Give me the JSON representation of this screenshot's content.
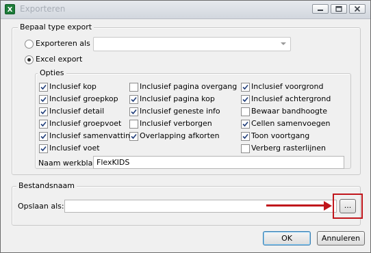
{
  "window": {
    "title": "Exporteren",
    "app_icon_glyph": "X",
    "app_icon_color": "#1d7c3a",
    "controls": [
      "minimize-icon",
      "maximize-icon",
      "close-icon"
    ]
  },
  "export_type": {
    "group_title": "Bepaal type export",
    "option_export_as_label": "Exporteren als :",
    "option_export_as_selected": false,
    "export_as_combo_value": "",
    "option_excel_label": "Excel export",
    "option_excel_selected": true
  },
  "options": {
    "group_title": "Opties",
    "checkboxes": [
      {
        "label": "Inclusief kop",
        "checked": true
      },
      {
        "label": "Inclusief groepkop",
        "checked": true
      },
      {
        "label": "Inclusief detail",
        "checked": true
      },
      {
        "label": "Inclusief groepvoet",
        "checked": true
      },
      {
        "label": "Inclusief samenvatting",
        "checked": true
      },
      {
        "label": "Inclusief voet",
        "checked": true
      },
      {
        "label": "Inclusief pagina overgang",
        "checked": false
      },
      {
        "label": "Inclusief pagina kop",
        "checked": true
      },
      {
        "label": "Inclusief geneste info",
        "checked": true
      },
      {
        "label": "Inclusief verborgen",
        "checked": false
      },
      {
        "label": "Overlapping afkorten",
        "checked": true
      },
      {
        "label": "Inclusief voorgrond",
        "checked": true
      },
      {
        "label": "Inclusief achtergrond",
        "checked": true
      },
      {
        "label": "Bewaar bandhoogte",
        "checked": false
      },
      {
        "label": "Cellen samenvoegen",
        "checked": true
      },
      {
        "label": "Toon voortgang",
        "checked": true
      },
      {
        "label": "Verberg rasterlijnen",
        "checked": false
      }
    ],
    "sheet_name_label": "Naam werkblad:",
    "sheet_name_value": "FlexKIDS"
  },
  "filename": {
    "group_title": "Bestandsnaam",
    "save_as_label": "Opslaan als:",
    "save_as_value": "",
    "browse_label": "...",
    "annotation_color": "#c0151b"
  },
  "buttons": {
    "ok_label": "OK",
    "cancel_label": "Annuleren"
  }
}
